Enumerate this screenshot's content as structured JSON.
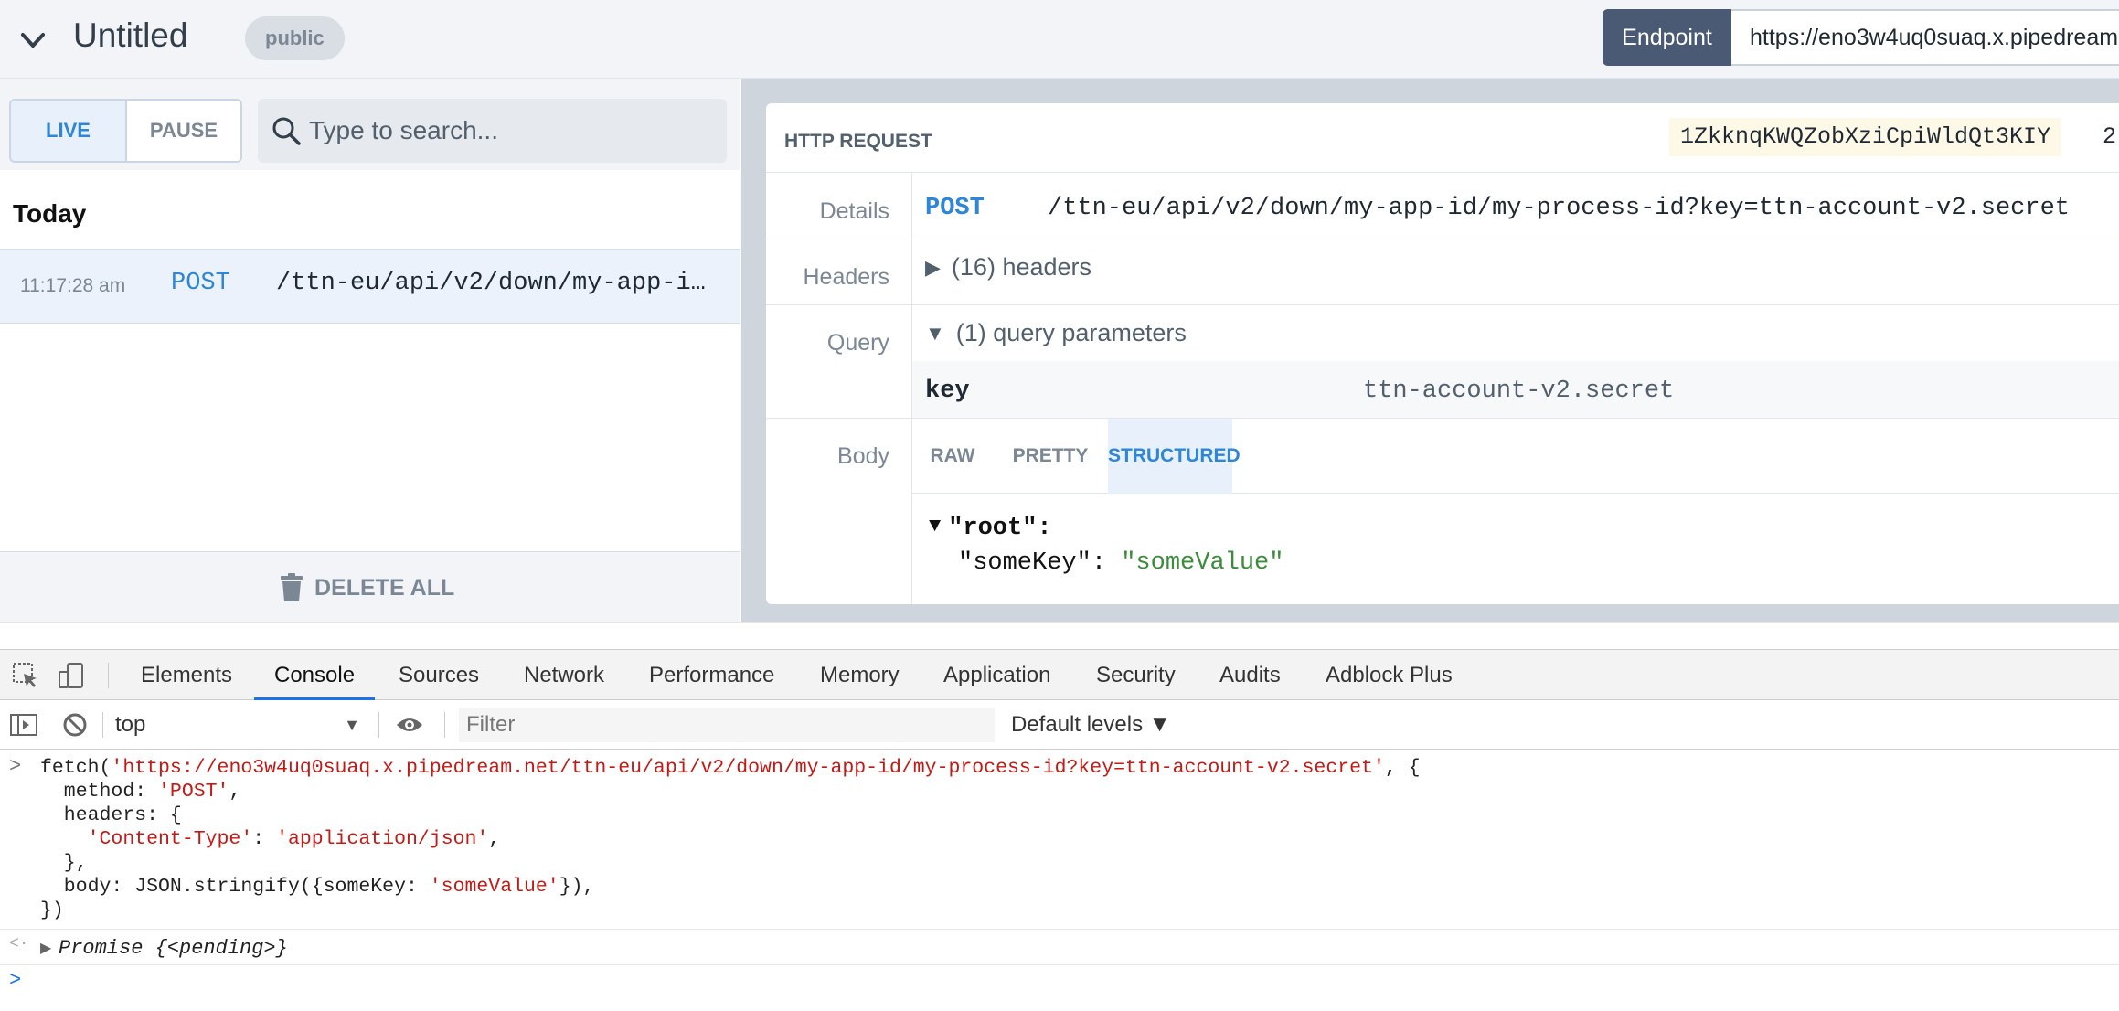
{
  "header": {
    "title": "Untitled",
    "visibility_badge": "public",
    "endpoint_label": "Endpoint",
    "endpoint_url": "https://eno3w4uq0suaq.x.pipedream"
  },
  "sidebar": {
    "live_label": "LIVE",
    "pause_label": "PAUSE",
    "search_placeholder": "Type to search...",
    "group_heading": "Today",
    "requests": [
      {
        "time": "11:17:28 am",
        "method": "POST",
        "path": "/ttn-eu/api/v2/down/my-app-i…"
      }
    ],
    "delete_all_label": "DELETE ALL"
  },
  "request": {
    "card_title": "HTTP REQUEST",
    "request_id": "1ZkknqKWQZobXziCpiWldQt3KIY",
    "request_id_overflow": "2",
    "details_label": "Details",
    "method": "POST",
    "path": "/ttn-eu/api/v2/down/my-app-id/my-process-id?key=ttn-account-v2.secret",
    "headers_label": "Headers",
    "headers_summary": "(16) headers",
    "query_label": "Query",
    "query_summary": "(1) query parameters",
    "query_params": [
      {
        "key": "key",
        "value": "ttn-account-v2.secret"
      }
    ],
    "body_label": "Body",
    "body_tabs": [
      "RAW",
      "PRETTY",
      "STRUCTURED"
    ],
    "active_body_tab": "STRUCTURED",
    "json_root": "\"root\":",
    "json_key": "\"someKey\":",
    "json_value": "\"someValue\""
  },
  "devtools": {
    "tabs": [
      "Elements",
      "Console",
      "Sources",
      "Network",
      "Performance",
      "Memory",
      "Application",
      "Security",
      "Audits",
      "Adblock Plus"
    ],
    "active_tab": "Console",
    "context": "top",
    "filter_placeholder": "Filter",
    "levels": "Default levels ▼",
    "console": {
      "l1_a": "fetch(",
      "l1_url": "'https://eno3w4uq0suaq.x.pipedream.net/ttn-eu/api/v2/down/my-app-id/my-process-id?key=ttn-account-v2.secret'",
      "l1_b": ", {",
      "l2_a": "  method: ",
      "l2_str": "'POST'",
      "l2_b": ",",
      "l3": "  headers: {",
      "l4_str1": "'Content-Type'",
      "l4_colon": ": ",
      "l4_str2": "'application/json'",
      "l4_b": ",",
      "l5": "  },",
      "l6_a": "  body: JSON.stringify({someKey: ",
      "l6_str": "'someValue'",
      "l6_b": "}),",
      "l7": "})",
      "result": "Promise {<pending>}"
    }
  }
}
